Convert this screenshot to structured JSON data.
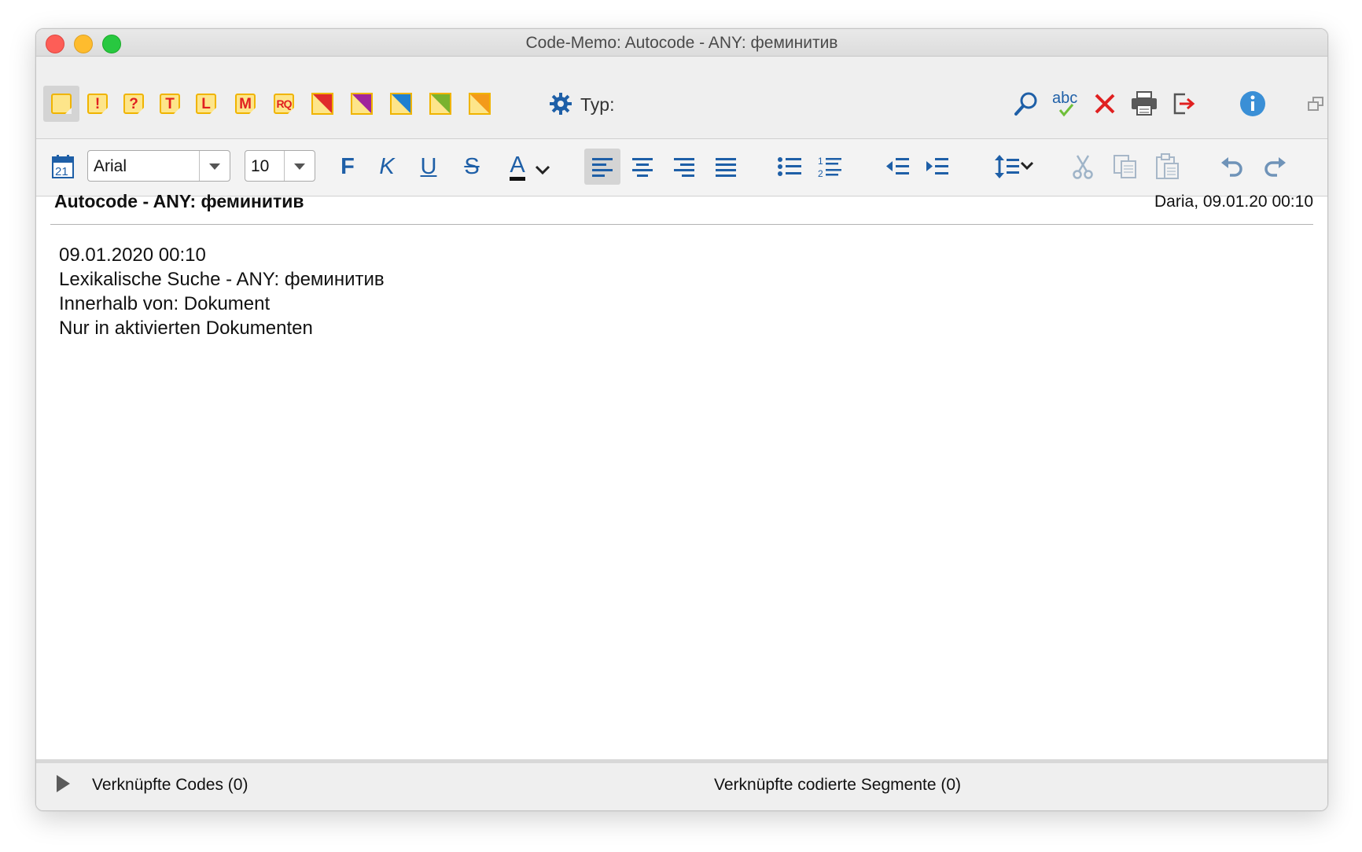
{
  "window": {
    "title": "Code-Memo: Autocode - ANY: феминитив"
  },
  "toolbar1": {
    "memo_types": [
      {
        "name": "memo-plain-icon",
        "glyph": ""
      },
      {
        "name": "memo-exclamation-icon",
        "glyph": "!"
      },
      {
        "name": "memo-question-icon",
        "glyph": "?"
      },
      {
        "name": "memo-t-icon",
        "glyph": "T"
      },
      {
        "name": "memo-l-icon",
        "glyph": "L"
      },
      {
        "name": "memo-m-icon",
        "glyph": "M"
      },
      {
        "name": "memo-rq-icon",
        "glyph": "RQ"
      }
    ],
    "colored_memos": [
      {
        "name": "memo-red-icon",
        "color": "#e02b2b"
      },
      {
        "name": "memo-purple-icon",
        "color": "#a0259c"
      },
      {
        "name": "memo-blue-icon",
        "color": "#1f7fd0"
      },
      {
        "name": "memo-green-icon",
        "color": "#7ab22e"
      },
      {
        "name": "memo-orange-icon",
        "color": "#f39a1a"
      }
    ],
    "typ_label": "Typ:"
  },
  "toolbar2": {
    "font_name": "Arial",
    "font_size": "10",
    "bold_label": "F",
    "italic_label": "K",
    "underline_label": "U",
    "strike_label": "S",
    "color_label": "A"
  },
  "memo": {
    "title": "Autocode - ANY: феминитив",
    "meta": "Daria, 09.01.20 00:10",
    "lines": [
      "09.01.2020 00:10",
      "Lexikalische Suche - ANY: феминитив",
      "Innerhalb von: Dokument",
      "Nur in aktivierten Dokumenten"
    ]
  },
  "footer": {
    "linked_codes": "Verknüpfte Codes (0)",
    "linked_segments": "Verknüpfte codierte Segmente (0)"
  },
  "colors": {
    "accent_blue": "#1e5fa7",
    "memo_yellow": "#fde58a",
    "memo_border": "#f0b400"
  }
}
